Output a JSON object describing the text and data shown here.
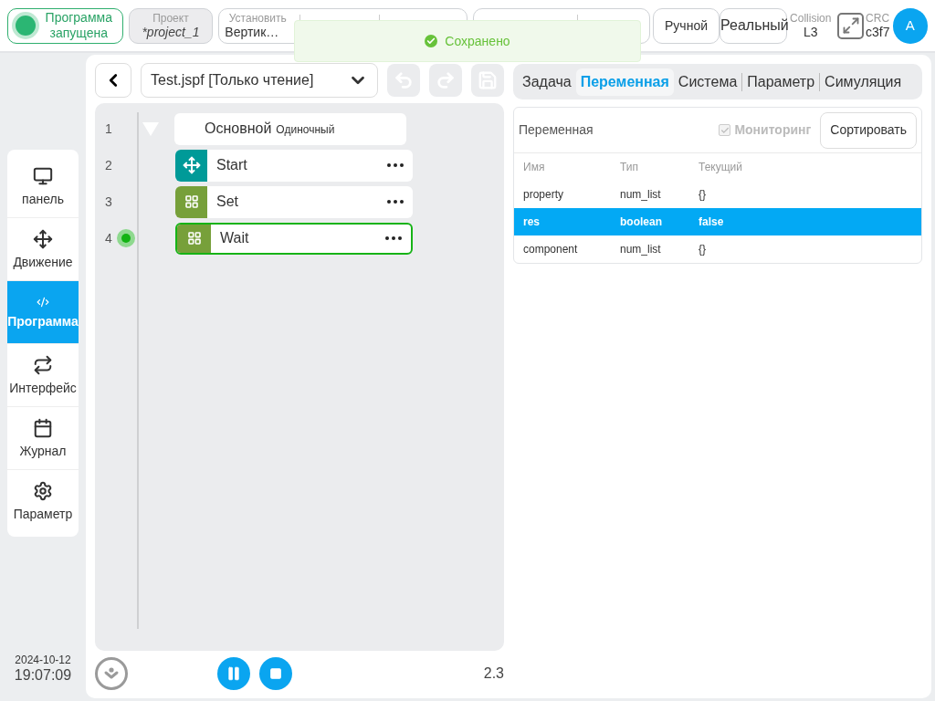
{
  "status": {
    "label": "Программа запущена"
  },
  "project": {
    "label": "Проект",
    "value": "*project_1"
  },
  "setting": {
    "label": "Установить",
    "value": "Вертик…"
  },
  "mode_buttons": [
    "Ручной",
    "Реальный"
  ],
  "collision": {
    "label": "Collision",
    "value": "L3"
  },
  "crc": {
    "label": "CRC",
    "value": "c3f7"
  },
  "avatar": "A",
  "toast": "Сохранено",
  "sidebar": {
    "items": [
      {
        "label": "панель",
        "selected": false
      },
      {
        "label": "Движение",
        "selected": false
      },
      {
        "label": "Программа",
        "selected": true
      },
      {
        "label": "Интерфейс",
        "selected": false
      },
      {
        "label": "Журнал",
        "selected": false
      },
      {
        "label": "Параметр",
        "selected": false
      }
    ]
  },
  "datetime": {
    "date": "2024-10-12",
    "time": "19:07:09"
  },
  "editor": {
    "file": "Test.jspf [Только чтение]",
    "version": "2.3",
    "nodes": [
      {
        "line": "1",
        "title": "Основной",
        "subtitle": "Одиночный",
        "expanded": true,
        "children": [
          {
            "line": "2",
            "kind": "move",
            "label": "Start",
            "selected": false,
            "current": false
          },
          {
            "line": "3",
            "kind": "logic",
            "label": "Set",
            "selected": false,
            "current": false
          },
          {
            "line": "4",
            "kind": "logic",
            "label": "Wait",
            "selected": true,
            "current": true
          }
        ]
      }
    ]
  },
  "tabs": [
    {
      "label": "Задача",
      "selected": false
    },
    {
      "label": "Переменная",
      "selected": true
    },
    {
      "label": "Система",
      "selected": false
    },
    {
      "label": "Параметр",
      "selected": false
    },
    {
      "label": "Симуляция",
      "selected": false
    }
  ],
  "variables": {
    "title": "Переменная",
    "monitoring": {
      "label": "Мониторинг",
      "checked": true
    },
    "sort_button": "Сортировать",
    "columns": [
      "Имя",
      "Тип",
      "Текущий"
    ],
    "rows": [
      {
        "cells": [
          "property",
          "num_list",
          "{}"
        ],
        "selected": false
      },
      {
        "cells": [
          "res",
          "boolean",
          "false"
        ],
        "selected": true
      },
      {
        "cells": [
          "component",
          "num_list",
          "{}"
        ],
        "selected": false
      }
    ]
  }
}
